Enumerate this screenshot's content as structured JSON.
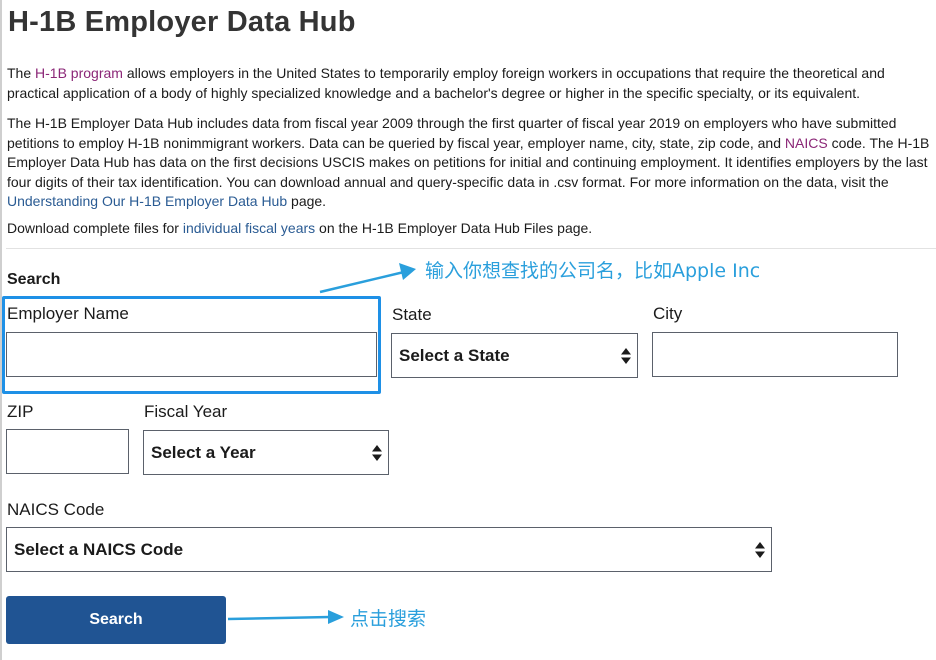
{
  "page": {
    "title": "H-1B Employer Data Hub"
  },
  "intro": {
    "p1_before": "The ",
    "p1_link": "H-1B program",
    "p1_after": " allows employers in the United States to temporarily employ foreign workers in occupations that require the theoretical and practical application of a body of highly specialized knowledge and a bachelor's degree or higher in the specific specialty, or its equivalent.",
    "p2_before": "The H-1B Employer Data Hub includes data from fiscal year 2009 through the first quarter of fiscal year 2019 on employers who have submitted petitions to employ H-1B nonimmigrant workers. Data can be queried by fiscal year, employer name, city, state, zip code, and ",
    "p2_link_naics": "NAICS",
    "p2_middle": " code. The H-1B Employer Data Hub has data on the first decisions USCIS makes on petitions for initial and continuing employment. It identifies employers by the last four digits of their tax identification. You can download annual and query-specific data in .csv format. For more information on the data, visit the ",
    "p2_link_understanding": "Understanding Our H-1B Employer Data Hub",
    "p2_after": " page.",
    "p3_before": "Download complete files for ",
    "p3_link": "individual fiscal years",
    "p3_after": " on the H-1B Employer Data Hub Files page."
  },
  "search": {
    "section_label": "Search",
    "employer_name_label": "Employer Name",
    "employer_name_value": "",
    "state_label": "State",
    "state_selected": "Select a State",
    "city_label": "City",
    "city_value": "",
    "zip_label": "ZIP",
    "zip_value": "",
    "fiscal_year_label": "Fiscal Year",
    "fiscal_year_selected": "Select a Year",
    "naics_label": "NAICS Code",
    "naics_selected": "Select a NAICS Code",
    "button_label": "Search"
  },
  "annotations": {
    "employer_hint": "输入你想查找的公司名，比如Apple Inc",
    "search_hint": "点击搜索"
  },
  "colors": {
    "button_bg": "#205493",
    "link_purple": "#8b2777",
    "link_blue": "#2a5b93",
    "annotation_blue": "#2a9fdc",
    "highlight_border": "#1e90e6"
  },
  "icons": {
    "select_caret": "up-down-caret-icon",
    "annotation_arrow": "arrow-icon"
  }
}
